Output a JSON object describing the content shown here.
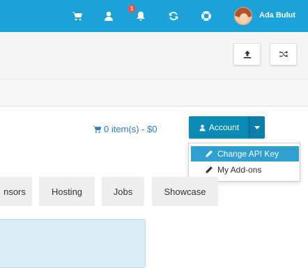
{
  "topbar": {
    "bg_color": "#1ba3d9",
    "icons": [
      "cart-icon",
      "user-icon",
      "bell-icon",
      "refresh-icon",
      "lifebuoy-icon"
    ],
    "notification_count": "1",
    "user_name": "Ada Bulut"
  },
  "toolbar": {
    "icons": [
      "upload-icon",
      "shuffle-icon"
    ]
  },
  "cart": {
    "label": "0 item(s) - $0",
    "color": "#2a7fc0"
  },
  "account": {
    "label": "Account",
    "color": "#0a8bb5",
    "menu": [
      {
        "label": "Change API Key",
        "icon": "pencil-icon",
        "active": true
      },
      {
        "label": "My Add-ons",
        "icon": "pencil-icon",
        "active": false
      }
    ]
  },
  "nav": {
    "tabs": [
      "nsors",
      "Hosting",
      "Jobs",
      "Showcase"
    ]
  }
}
